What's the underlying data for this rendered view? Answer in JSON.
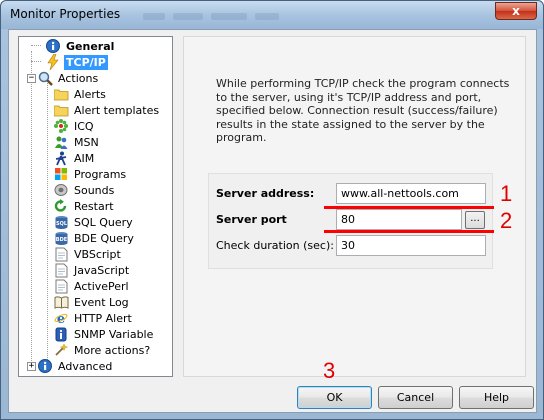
{
  "window": {
    "title": "Monitor Properties",
    "close_glyph": "x"
  },
  "tree": {
    "general": {
      "label": "General",
      "icon": "info-icon"
    },
    "tcpip": {
      "label": "TCP/IP",
      "icon": "lightning-icon"
    },
    "actions": {
      "label": "Actions",
      "icon": "magnifier-icon"
    },
    "action_items": [
      {
        "label": "Alerts",
        "icon": "folder-icon"
      },
      {
        "label": "Alert templates",
        "icon": "folder-icon"
      },
      {
        "label": "ICQ",
        "icon": "icq-icon"
      },
      {
        "label": "MSN",
        "icon": "msn-icon"
      },
      {
        "label": "AIM",
        "icon": "aim-icon"
      },
      {
        "label": "Programs",
        "icon": "windows-icon"
      },
      {
        "label": "Sounds",
        "icon": "speaker-icon"
      },
      {
        "label": "Restart",
        "icon": "restart-icon"
      },
      {
        "label": "SQL Query",
        "icon": "sql-icon"
      },
      {
        "label": "BDE Query",
        "icon": "bde-icon"
      },
      {
        "label": "VBScript",
        "icon": "script-icon"
      },
      {
        "label": "JavaScript",
        "icon": "script-icon"
      },
      {
        "label": "ActivePerl",
        "icon": "script-icon"
      },
      {
        "label": "Event Log",
        "icon": "book-icon"
      },
      {
        "label": "HTTP Alert",
        "icon": "ie-icon"
      },
      {
        "label": "SNMP Variable",
        "icon": "snmp-icon"
      },
      {
        "label": "More actions?",
        "icon": "more-icon"
      }
    ],
    "advanced": {
      "label": "Advanced",
      "icon": "info-icon"
    },
    "expander_plus": "+",
    "expander_minus": "−"
  },
  "content": {
    "description": "While performing TCP/IP check the program connects to the server, using it's TCP/IP address and port, specified below. Connection result (success/failure) results in the state assigned to the server by the program.",
    "server_address_label": "Server address:",
    "server_address_value": "www.all-nettools.com",
    "server_port_label": "Server port",
    "server_port_value": "80",
    "browse_label": "...",
    "check_duration_label": "Check duration (sec):",
    "check_duration_value": "30"
  },
  "buttons": {
    "ok": "OK",
    "cancel": "Cancel",
    "help": "Help"
  },
  "annotations": {
    "n1": "1",
    "n2": "2",
    "n3": "3",
    "color": "#ff0000"
  },
  "colors": {
    "selection": "#3399ff",
    "title_bar": "#a8c4e0"
  }
}
